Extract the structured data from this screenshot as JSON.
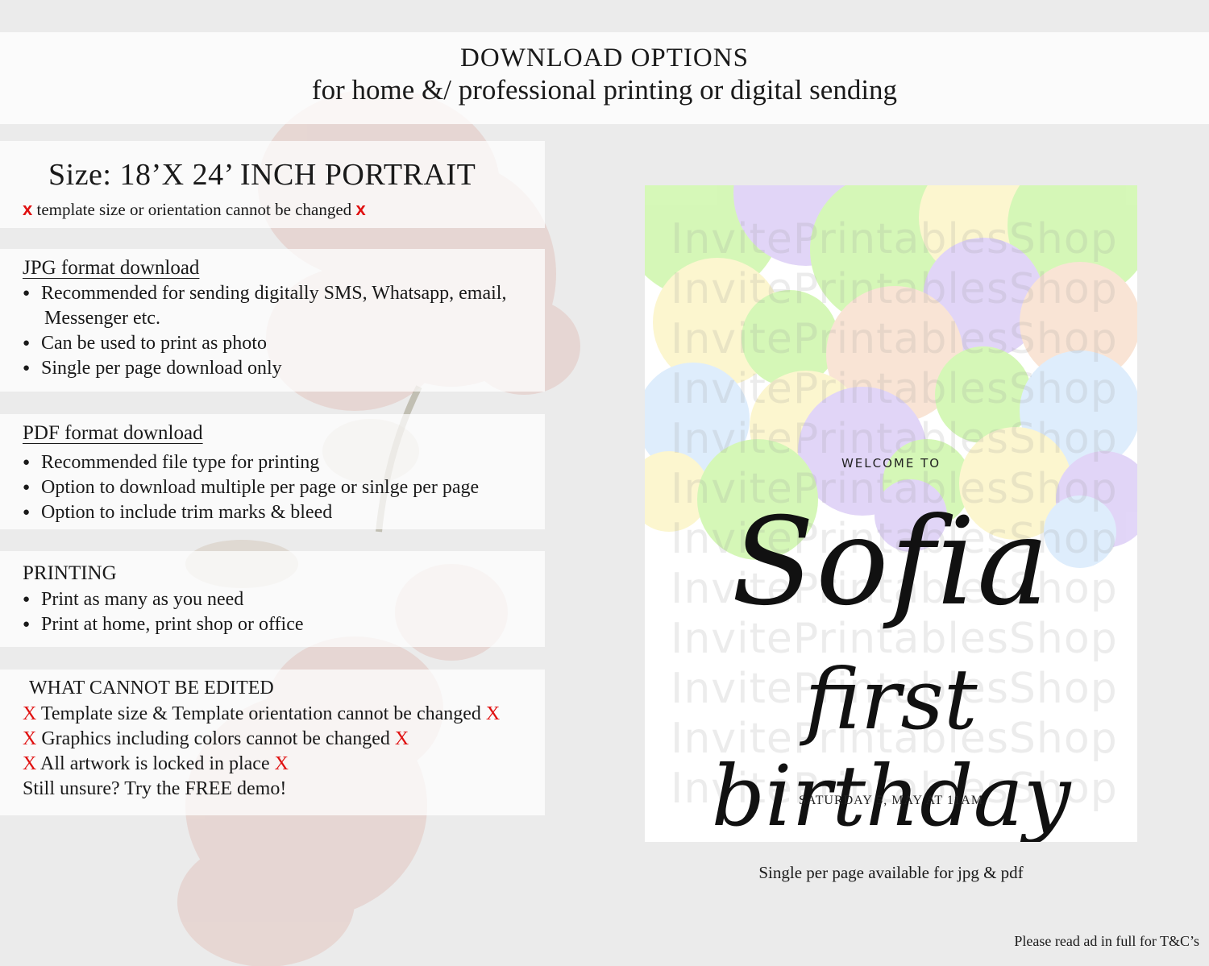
{
  "header": {
    "title": "DOWNLOAD OPTIONS",
    "subtitle": "for home &/ professional printing or digital sending"
  },
  "size_panel": {
    "title": "Size: 18’X 24’ INCH PORTRAIT",
    "note": "template size or orientation cannot be changed",
    "mark": "x"
  },
  "jpg_panel": {
    "heading": "JPG format download",
    "items": [
      "Recommended for sending digitally SMS, Whatsapp, email,",
      "Messenger etc.",
      "Can be used to print as photo",
      "Single per page download only"
    ]
  },
  "pdf_panel": {
    "heading": "PDF format download",
    "items": [
      "Recommended file type for printing",
      "Option to download multiple per page or sinlge per page",
      "Option to include trim marks & bleed"
    ]
  },
  "printing_panel": {
    "heading": "PRINTING",
    "items": [
      "Print as many as you need",
      "Print at home, print shop or office"
    ]
  },
  "edit_panel": {
    "heading": "WHAT CANNOT BE EDITED",
    "mark": "X",
    "lines": [
      "Template size & Template orientation cannot be changed",
      "Graphics including colors cannot be changed",
      "All artwork is locked in place"
    ],
    "closing": "Still unsure? Try the FREE demo!"
  },
  "card": {
    "watermark": "InvitePrintablesShop",
    "welcome": "WELCOME TO",
    "name": "Sofia",
    "event": "first birthday",
    "date": "SATURDAY 5, MAY AT 11AM"
  },
  "caption": "Single per page available for jpg & pdf",
  "footnote": "Please read ad in full for T&C’s",
  "colors": {
    "accent_red": "#e01010",
    "balloon_green": "#c8f5a0",
    "balloon_purple": "#d8c8f5",
    "balloon_yellow": "#fbf3c0",
    "balloon_blue": "#d4e8fb",
    "balloon_peach": "#f7dcc8"
  }
}
